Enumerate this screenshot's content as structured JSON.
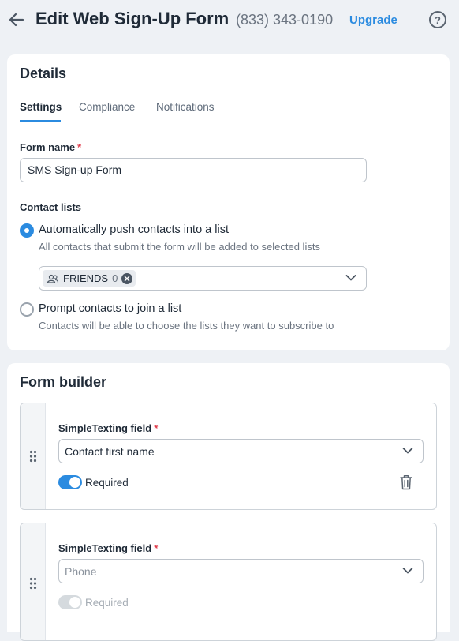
{
  "header": {
    "title": "Edit Web Sign-Up Form",
    "phone": "(833) 343-0190",
    "upgrade_label": "Upgrade",
    "help_glyph": "?",
    "back_icon": "arrow-left-icon",
    "help_icon": "question-circle-icon"
  },
  "details": {
    "title": "Details",
    "tabs": [
      {
        "label": "Settings",
        "active": true
      },
      {
        "label": "Compliance",
        "active": false
      },
      {
        "label": "Notifications",
        "active": false
      }
    ],
    "form_name": {
      "label": "Form name",
      "required_mark": "*",
      "value": "SMS Sign-up Form"
    },
    "contact_lists": {
      "label": "Contact lists",
      "options": [
        {
          "label": "Automatically push contacts into a list",
          "description": "All contacts that submit the form will be added to selected lists",
          "checked": true
        },
        {
          "label": "Prompt contacts to join a list",
          "description": "Contacts will be able to choose the lists they want to subscribe to",
          "checked": false
        }
      ],
      "selected_list": {
        "name": "FRIENDS",
        "count": "0"
      }
    }
  },
  "form_builder": {
    "title": "Form builder",
    "fields": [
      {
        "label": "SimpleTexting field",
        "required_mark": "*",
        "value": "Contact first name",
        "placeholder": false,
        "required_label": "Required",
        "required_on": true,
        "disabled": false
      },
      {
        "label": "SimpleTexting field",
        "required_mark": "*",
        "value": "Phone",
        "placeholder": true,
        "required_label": "Required",
        "required_on": true,
        "disabled": true
      }
    ]
  },
  "colors": {
    "accent": "#2b8be0",
    "required_star": "#e03a4a",
    "background": "#eef1f5"
  }
}
